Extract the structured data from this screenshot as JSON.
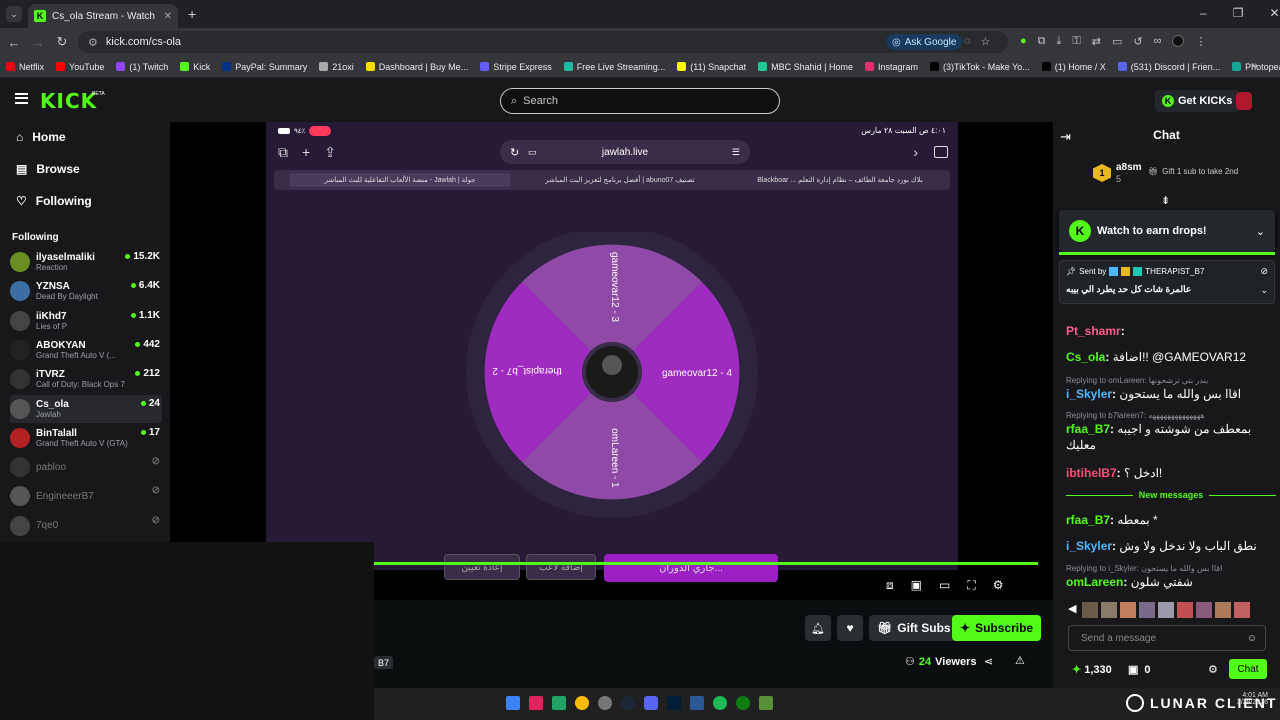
{
  "browser": {
    "tab_title": "Cs_ola Stream - Watch Live on K",
    "url": "kick.com/cs-ola",
    "ask_google": "Ask Google",
    "bookmarks": [
      {
        "label": "Netflix",
        "color": "#e50914"
      },
      {
        "label": "YouTube",
        "color": "#ff0000"
      },
      {
        "label": "(1) Twitch",
        "color": "#9146ff"
      },
      {
        "label": "Kick",
        "color": "#53fc18"
      },
      {
        "label": "PayPal: Summary",
        "color": "#003087"
      },
      {
        "label": "21oxi",
        "color": "#aaaaaa"
      },
      {
        "label": "Dashboard | Buy Me...",
        "color": "#ffdd00"
      },
      {
        "label": "Stripe Express",
        "color": "#635bff"
      },
      {
        "label": "Free Live Streaming...",
        "color": "#1db9a0"
      },
      {
        "label": "(11) Snapchat",
        "color": "#fffc00"
      },
      {
        "label": "MBC Shahid | Home",
        "color": "#1ec893"
      },
      {
        "label": "Instagram",
        "color": "#e1306c"
      },
      {
        "label": "(3)TikTok - Make Yo...",
        "color": "#000000"
      },
      {
        "label": "(1) Home / X",
        "color": "#000000"
      },
      {
        "label": "(531) Discord | Frien...",
        "color": "#5865f2"
      },
      {
        "label": "Photopea | Online P...",
        "color": "#18a497"
      }
    ]
  },
  "kick": {
    "logo": "KICK",
    "logo_badge": "BETA",
    "search_placeholder": "Search",
    "get_kicks": "Get KICKs",
    "nav": [
      "Home",
      "Browse",
      "Following"
    ],
    "following_title": "Following",
    "following": [
      {
        "name": "ilyaselmaliki",
        "category": "Reaction",
        "viewers": "15.2K",
        "live": true,
        "color": "#6b8e23"
      },
      {
        "name": "YZNSA",
        "category": "Dead By Daylight",
        "viewers": "6.4K",
        "live": true,
        "color": "#3a6ea5"
      },
      {
        "name": "iiKhd7",
        "category": "Lies of P",
        "viewers": "1.1K",
        "live": true,
        "color": "#444"
      },
      {
        "name": "ABOKYAN",
        "category": "Grand Theft Auto V (...",
        "viewers": "442",
        "live": true,
        "color": "#222"
      },
      {
        "name": "iTVRZ",
        "category": "Call of Duty: Black Ops 7",
        "viewers": "212",
        "live": true,
        "color": "#333"
      },
      {
        "name": "Cs_ola",
        "category": "Jawlah",
        "viewers": "24",
        "live": true,
        "color": "#555"
      },
      {
        "name": "BinTalall",
        "category": "Grand Theft Auto V (GTA)",
        "viewers": "17",
        "live": true,
        "color": "#b22222"
      },
      {
        "name": "pabloo",
        "category": "",
        "viewers": "",
        "live": false,
        "color": "#333"
      },
      {
        "name": "EngineeerB7",
        "category": "",
        "viewers": "",
        "live": false,
        "color": "#555"
      },
      {
        "name": "7qe0",
        "category": "",
        "viewers": "",
        "live": false,
        "color": "#444"
      }
    ]
  },
  "stream": {
    "phone_status_time": "٤:٠١ ص   السبت ٢٨ مارس",
    "phone_battery": "٩٤٪",
    "phone_url": "jawlah.live",
    "phone_tabs": [
      "جولة | Jawlah - منصة الألعاب التفاعلية للبث المباشر",
      "تصنيف abuno07 | أفضل برنامج لتعزيز البث المباشر",
      "بلاك بورد جامعة الطائف – نظام إدارة التعلم ... Blackboar"
    ],
    "wheel_segments": [
      "gameovar12 - 3",
      "gameovar12 - 4",
      "omLareen - 1",
      "therapist_b7 - 2"
    ],
    "spin_button": "جاري الدوران...",
    "add_button": "إضافة لاعب",
    "reset_button": "إعادة تعيين",
    "actions": {
      "gift_subs": "Gift Subs",
      "subscribe": "Subscribe"
    },
    "viewers": "24",
    "viewers_label": "Viewers",
    "tag": "B7"
  },
  "chat": {
    "title": "Chat",
    "top_gifter": "a8sm",
    "top_gifter_count": "5",
    "gift_prompt": "Gift 1 sub to take 2nd",
    "drops_text": "Watch to earn drops!",
    "pinned_sent_by": "Sent by",
    "pinned_user": "THERAPIST_B7",
    "pinned_message": "عالمرة شات كل حد يطرد الي بيبه",
    "messages": [
      {
        "reply": "",
        "user": "Pt_shamr",
        "color": "#ff5c8a",
        "text": ""
      },
      {
        "reply": "",
        "user": "Cs_ola",
        "color": "#53fc18",
        "text": "اضافة!! @GAMEOVAR12"
      },
      {
        "reply": "Replying to omLareen: بندر بتي ترشحونها",
        "user": "i_Skyler",
        "color": "#4db8ff",
        "text": "اقاا بس والله ما يستحون"
      },
      {
        "reply": "Replying to b7lareen7: ههههههههههههههه",
        "user": "rfaa_B7",
        "color": "#53fc18",
        "text": "بمعطف من شوشته و اجيبه معليك"
      },
      {
        "reply": "",
        "user": "ibtihelB7",
        "color": "#ff4f7a",
        "text": "ادخل ؟!"
      },
      {
        "reply": "",
        "user": "rfaa_B7",
        "color": "#53fc18",
        "text": "بمعطه *"
      },
      {
        "reply": "",
        "user": "i_Skyler",
        "color": "#4db8ff",
        "text": "نطق الباب ولا ندخل ولا وش"
      },
      {
        "reply": "Replying to i_Skyler: اقاا بس والله ما يستحون",
        "user": "omLareen",
        "color": "#53fc18",
        "text": "شفتي شلون"
      }
    ],
    "new_messages": "New messages",
    "input_placeholder": "Send a message",
    "points": "1,330",
    "zero": "0",
    "chat_button": "Chat"
  },
  "taskbar": {
    "watermark": "LUNAR CLIENT",
    "time": "4:01 AM",
    "date": "3/28/2026"
  }
}
